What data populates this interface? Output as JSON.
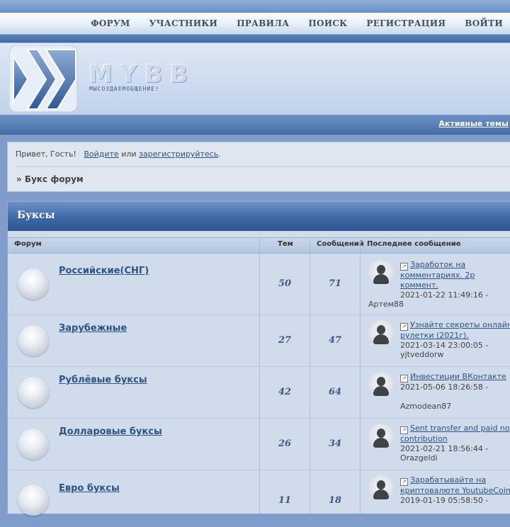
{
  "nav": {
    "items": [
      "ФОРУМ",
      "УЧАСТНИКИ",
      "ПРАВИЛА",
      "ПОИСК",
      "РЕГИСТРАЦИЯ",
      "ВОЙТИ"
    ]
  },
  "header": {
    "logo_text": "MYBB",
    "slogan": "МЫСОЗДАЕМОБЩЕНИЕ!"
  },
  "active_topics_link": "Активные темы",
  "welcome": {
    "greeting": "Привет, Гость!",
    "login_link": "Войдите",
    "or_text": "или",
    "register_link": "зарегистрируйтесь",
    "period": "."
  },
  "breadcrumb": "» Букс форум",
  "category": {
    "title": "Буксы",
    "columns": {
      "forum": "Форум",
      "topics": "Тем",
      "posts": "Сообщений",
      "last_post": "Последнее сообщение"
    },
    "forums": [
      {
        "name": "Российские(СНГ)",
        "topics": "50",
        "posts": "71",
        "last_post": {
          "title": "Заработок на комментариях. 2р коммент.",
          "date": "2021-01-22 11:49:16 -",
          "author": "Артем88"
        }
      },
      {
        "name": "Зарубежные",
        "topics": "27",
        "posts": "47",
        "last_post": {
          "title": "Узнайте секреты онлайн рулетки (2021г).",
          "date": "2021-03-14 23:00:05 -",
          "author": "yjtveddorw"
        }
      },
      {
        "name": "Рублёвые буксы",
        "topics": "42",
        "posts": "64",
        "last_post": {
          "title": "Инвестиции ВКонтакте",
          "date": "2021-05-06 18:26:58 -",
          "author": "Azmodean87"
        }
      },
      {
        "name": "Долларовые буксы",
        "topics": "26",
        "posts": "34",
        "last_post": {
          "title": "Sent transfer and paid no contribution",
          "date": "2021-02-21 18:56:44 -",
          "author": "Orazgeldi"
        }
      },
      {
        "name": "Евро буксы",
        "topics": "11",
        "posts": "18",
        "last_post": {
          "title": "Зарабатывайте на криптовалюте YoutubeCoin",
          "date": "2019-01-19 05:58:50 -",
          "author": ""
        }
      }
    ]
  }
}
